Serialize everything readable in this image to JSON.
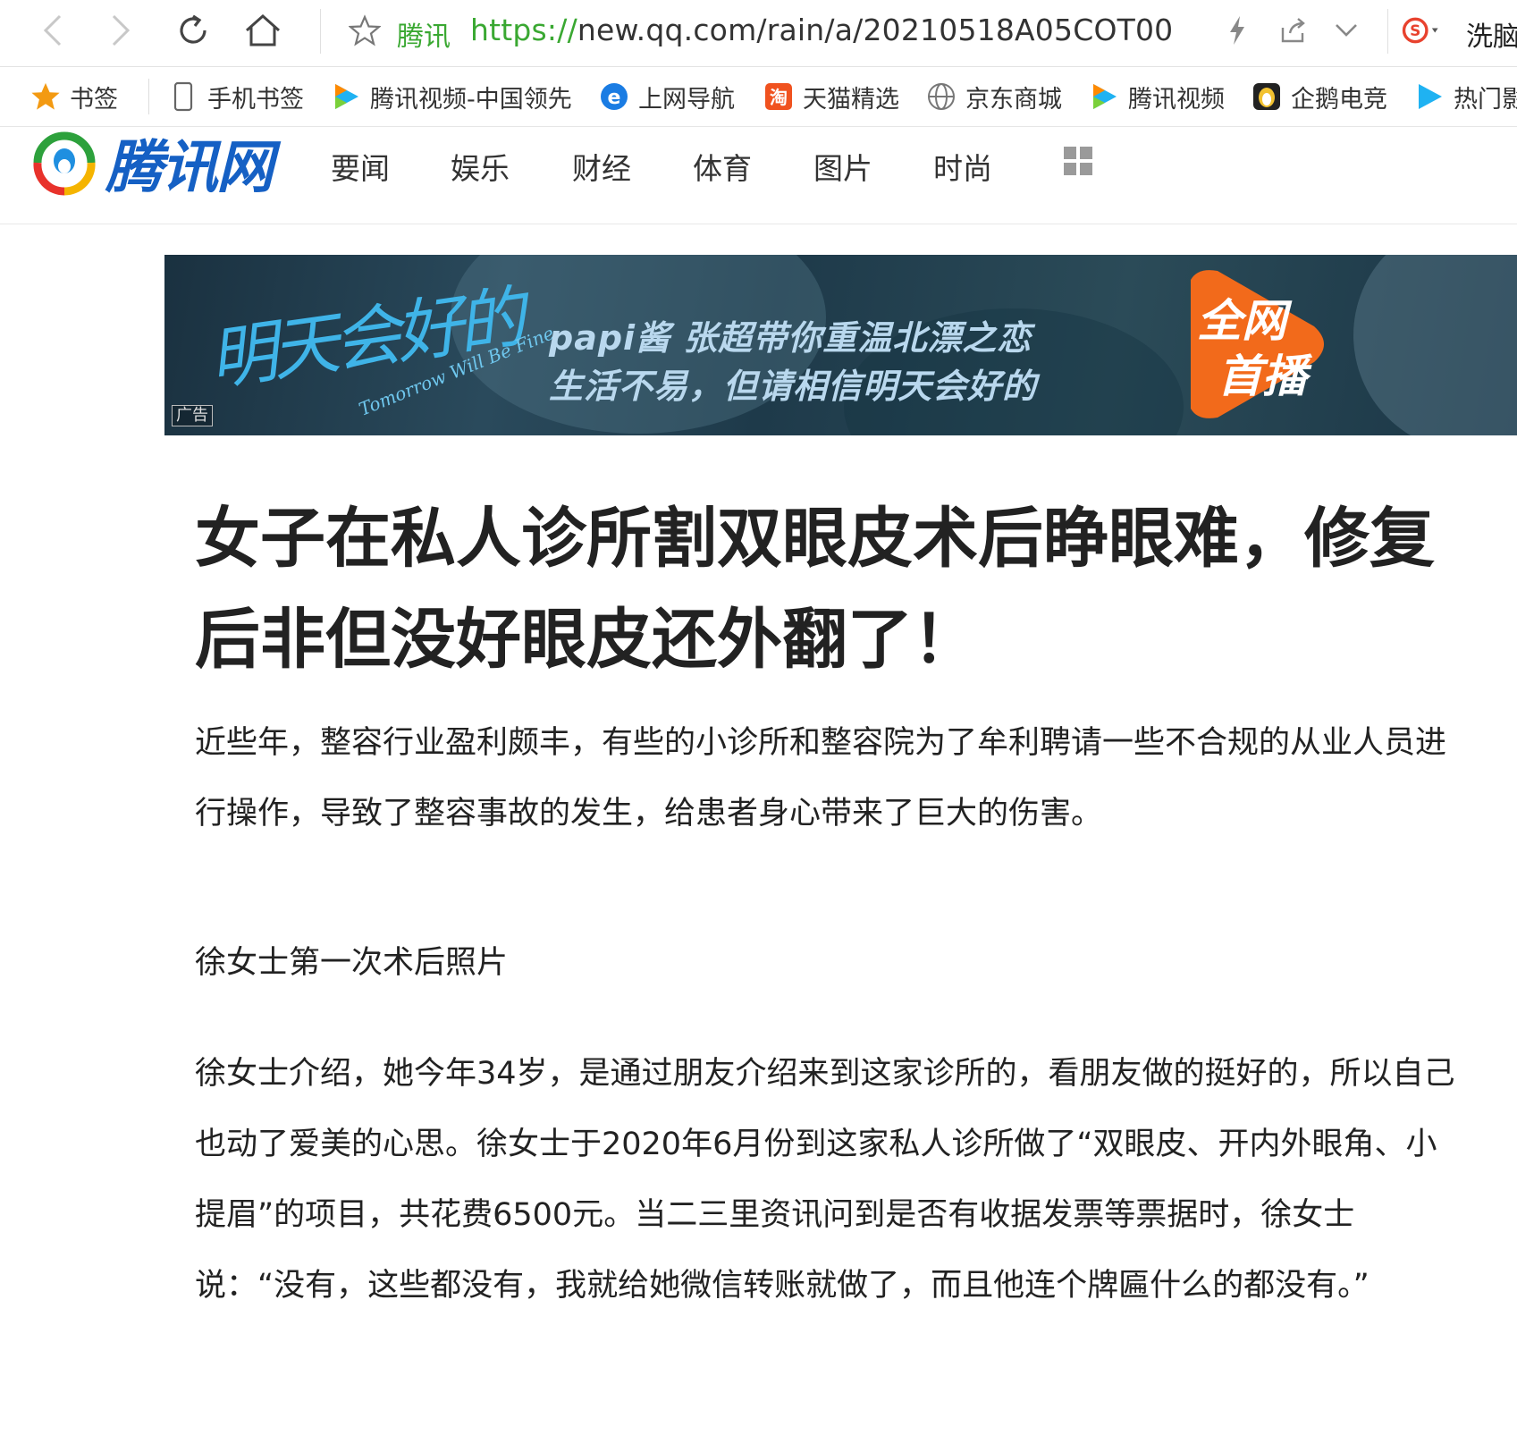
{
  "browser": {
    "secure_label": "腾讯",
    "url_protocol": "https://",
    "url_rest": "new.qq.com/rain/a/20210518A05COT00",
    "right_label": "洗脑"
  },
  "bookmarks": [
    {
      "label": "书签",
      "icon": "star-icon"
    },
    {
      "label": "手机书签",
      "icon": "phone-icon"
    },
    {
      "label": "腾讯视频-中国领先",
      "icon": "play-icon"
    },
    {
      "label": "上网导航",
      "icon": "ie-icon"
    },
    {
      "label": "天猫精选",
      "icon": "tmall-icon"
    },
    {
      "label": "京东商城",
      "icon": "globe-icon"
    },
    {
      "label": "腾讯视频",
      "icon": "play-icon"
    },
    {
      "label": "企鹅电竞",
      "icon": "penguin-icon"
    },
    {
      "label": "热门影",
      "icon": "play-icon"
    }
  ],
  "site": {
    "logo_text": "腾讯网",
    "nav": [
      "要闻",
      "娱乐",
      "财经",
      "体育",
      "图片",
      "时尚"
    ]
  },
  "ad": {
    "script_text": "明天会好的",
    "sub_text": "Tomorrow Will Be Fine",
    "line1": "papi酱  张超带你重温北漂之恋",
    "line2": "生活不易，但请相信明天会好的",
    "badge_line1": "全网",
    "badge_line2": "首播",
    "tag": "广告"
  },
  "article": {
    "headline": "女子在私人诊所割双眼皮术后睁眼难，修复后非但没好眼皮还外翻了！",
    "para1": "近些年，整容行业盈利颇丰，有些的小诊所和整容院为了牟利聘请一些不合规的从业人员进行操作，导致了整容事故的发生，给患者身心带来了巨大的伤害。",
    "caption": "徐女士第一次术后照片",
    "para2": "徐女士介绍，她今年34岁，是通过朋友介绍来到这家诊所的，看朋友做的挺好的，所以自己也动了爱美的心思。徐女士于2020年6月份到这家私人诊所做了“双眼皮、开内外眼角、小提眉”的项目，共花费6500元。当二三里资讯问到是否有收据发票等票据时，徐女士说：“没有，这些都没有，我就给她微信转账就做了，而且他连个牌匾什么的都没有。”"
  },
  "colors": {
    "secure_green": "#3aa832",
    "logo_blue": "#1560c4",
    "badge_orange": "#f26a1b"
  }
}
